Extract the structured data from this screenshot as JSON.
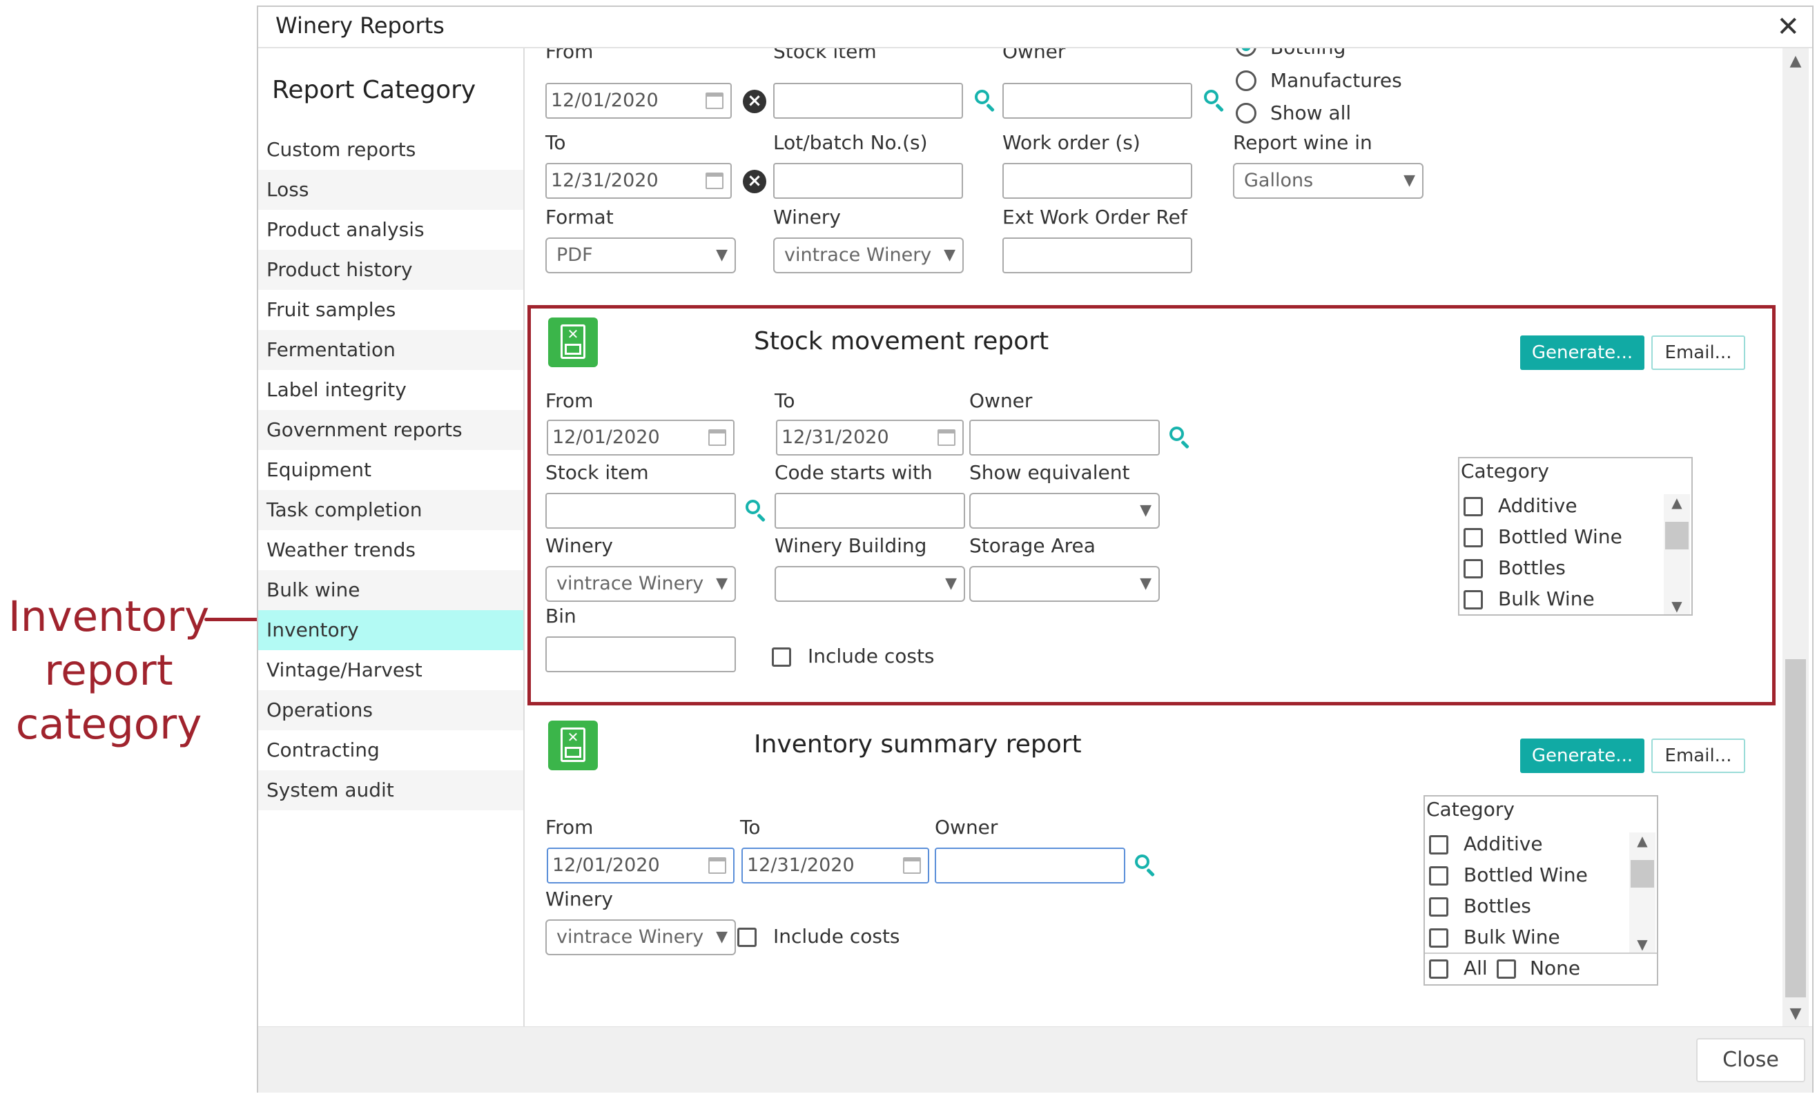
{
  "annotation": {
    "lines": [
      "Inventory",
      "report",
      "category"
    ]
  },
  "window": {
    "title": "Winery Reports",
    "close_glyph": "✕"
  },
  "sidebar": {
    "heading": "Report Category",
    "items": [
      {
        "label": "Custom reports"
      },
      {
        "label": "Loss"
      },
      {
        "label": "Product analysis"
      },
      {
        "label": "Product history"
      },
      {
        "label": "Fruit samples"
      },
      {
        "label": "Fermentation"
      },
      {
        "label": "Label integrity"
      },
      {
        "label": "Government reports"
      },
      {
        "label": "Equipment"
      },
      {
        "label": "Task completion"
      },
      {
        "label": "Weather trends"
      },
      {
        "label": "Bulk wine"
      },
      {
        "label": "Inventory"
      },
      {
        "label": "Vintage/Harvest"
      },
      {
        "label": "Operations"
      },
      {
        "label": "Contracting"
      },
      {
        "label": "System audit"
      }
    ],
    "active_item": "Inventory"
  },
  "top_form": {
    "from_label": "From",
    "from_value": "12/01/2020",
    "stock_item_label": "Stock item",
    "owner_label": "Owner",
    "radio_bottling": "Bottling",
    "radio_manufactures": "Manufactures",
    "radio_show_all": "Show all",
    "to_label": "To",
    "to_value": "12/31/2020",
    "lot_label": "Lot/batch No.(s)",
    "work_order_label": "Work order (s)",
    "report_wine_label": "Report wine in",
    "report_wine_value": "Gallons",
    "format_label": "Format",
    "format_value": "PDF",
    "winery_label": "Winery",
    "winery_value": "vintrace Winery",
    "ext_work_label": "Ext Work Order Ref"
  },
  "stock_movement": {
    "title": "Stock movement report",
    "generate": "Generate...",
    "email": "Email...",
    "from_label": "From",
    "from_value": "12/01/2020",
    "to_label": "To",
    "to_value": "12/31/2020",
    "owner_label": "Owner",
    "stock_item_label": "Stock item",
    "code_label": "Code starts with",
    "show_equiv_label": "Show equivalent",
    "winery_label": "Winery",
    "winery_value": "vintrace Winery",
    "building_label": "Winery Building",
    "storage_label": "Storage Area",
    "bin_label": "Bin",
    "include_costs": "Include costs",
    "category_label": "Category",
    "categories": [
      "Additive",
      "Bottled Wine",
      "Bottles",
      "Bulk Wine"
    ]
  },
  "inventory_summary": {
    "title": "Inventory summary report",
    "generate": "Generate...",
    "email": "Email...",
    "from_label": "From",
    "from_value": "12/01/2020",
    "to_label": "To",
    "to_value": "12/31/2020",
    "owner_label": "Owner",
    "winery_label": "Winery",
    "winery_value": "vintrace Winery",
    "include_costs": "Include costs",
    "category_label": "Category",
    "categories": [
      "Additive",
      "Bottled Wine",
      "Bottles",
      "Bulk Wine"
    ],
    "all_label": "All",
    "none_label": "None"
  },
  "footer": {
    "close": "Close"
  },
  "colors": {
    "accent": "#11aaa4",
    "highlight": "#a0232d",
    "active_bg": "#b3faf4",
    "excel_green": "#3bb54a"
  }
}
